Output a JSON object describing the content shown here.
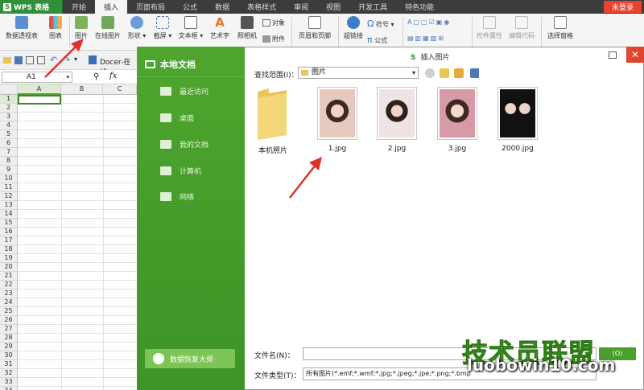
{
  "app": {
    "name": "WPS 表格",
    "login": "未登录"
  },
  "menu": [
    "开始",
    "插入",
    "页面布局",
    "公式",
    "数据",
    "表格样式",
    "审阅",
    "视图",
    "开发工具",
    "特色功能"
  ],
  "active_menu": "插入",
  "ribbon": {
    "pivot": "数据透视表",
    "chart": "图表",
    "picture": "图片",
    "online_picture": "在线图片",
    "shape": "形状",
    "screenshot": "截屏",
    "textbox": "文本框",
    "wordart": "艺术字",
    "camera": "照相机",
    "object": "对象",
    "attachment": "附件",
    "header_footer": "页眉和页脚",
    "hyperlink": "超链接",
    "symbol": "符号",
    "formula": "公式",
    "control_props": "控件属性",
    "edit_code": "编辑代码",
    "selection_pane": "选择窗格"
  },
  "docer_tab": "Docer-在线",
  "namebox": "A1",
  "fx": "fx",
  "columns": [
    "A",
    "B",
    "C"
  ],
  "rows": [
    "1",
    "2",
    "3",
    "4",
    "5",
    "6",
    "7",
    "8",
    "9",
    "10",
    "11",
    "12",
    "13",
    "14",
    "15",
    "16",
    "17",
    "18",
    "19",
    "20",
    "21",
    "22",
    "23",
    "24",
    "25",
    "26",
    "27",
    "28",
    "29",
    "30",
    "31",
    "32",
    "33",
    "34"
  ],
  "dialog": {
    "title": "插入图片",
    "side_title": "本地文档",
    "side_items": [
      "最近访问",
      "桌面",
      "我的文档",
      "计算机",
      "网络"
    ],
    "restore": "数据恢复大师",
    "lookin_label": "查找范围(I)：",
    "lookin_value": "图片",
    "files": [
      "本机照片",
      "1.jpg",
      "2.jpg",
      "3.jpg",
      "2000.jpg"
    ],
    "filename_label": "文件名(N)：",
    "filename_value": "",
    "filetype_label": "文件类型(T)：",
    "filetype_value": "所有图片(*.emf;*.wmf;*.jpg;*.jpeg;*.jpe;*.png;*.bmp",
    "open_button": "(O)"
  },
  "watermark": {
    "logo": "技术员联盟",
    "url": "luobowin10.com"
  },
  "colors": {
    "accent_green": "#3e9426",
    "menubar": "#3c3c3c",
    "close_red": "#e0452f",
    "arrow_red": "#e0302a"
  }
}
